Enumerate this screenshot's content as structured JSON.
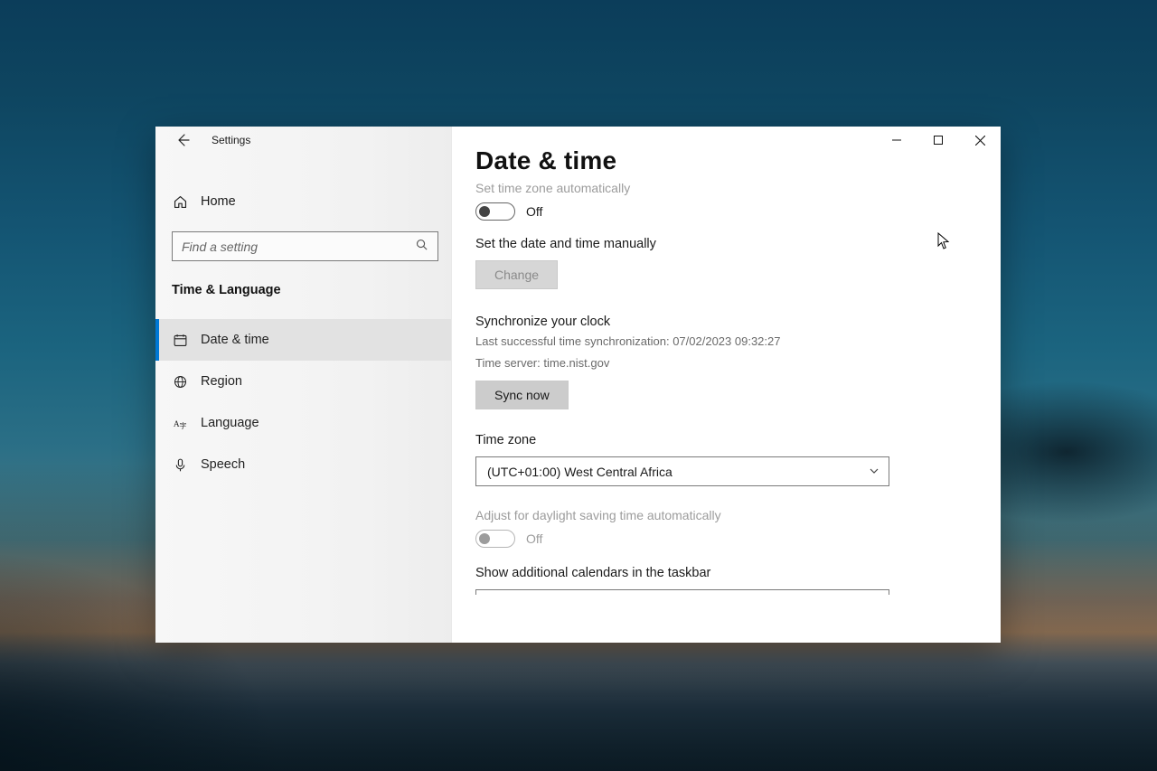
{
  "window": {
    "title": "Settings"
  },
  "sidebar": {
    "home_label": "Home",
    "search_placeholder": "Find a setting",
    "category": "Time & Language",
    "items": [
      {
        "label": "Date & time"
      },
      {
        "label": "Region"
      },
      {
        "label": "Language"
      },
      {
        "label": "Speech"
      }
    ]
  },
  "page": {
    "title": "Date & time",
    "auto_tz_label": "Set time zone automatically",
    "auto_tz_state": "Off",
    "manual_label": "Set the date and time manually",
    "change_btn": "Change",
    "sync_heading": "Synchronize your clock",
    "sync_last": "Last successful time synchronization: 07/02/2023 09:32:27",
    "sync_server": "Time server: time.nist.gov",
    "sync_btn": "Sync now",
    "tz_label": "Time zone",
    "tz_value": "(UTC+01:00) West Central Africa",
    "dst_label": "Adjust for daylight saving time automatically",
    "dst_state": "Off",
    "calendars_label": "Show additional calendars in the taskbar"
  }
}
